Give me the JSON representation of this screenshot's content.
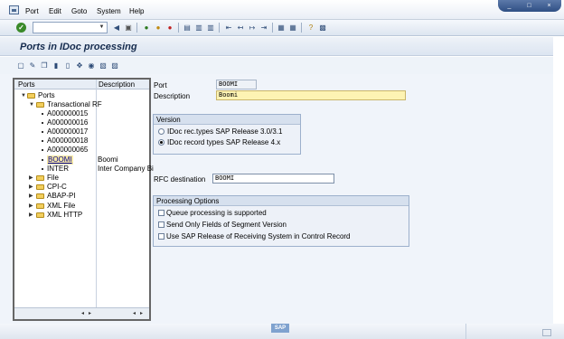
{
  "menu": {
    "items": [
      "Port",
      "Edit",
      "Goto",
      "System",
      "Help"
    ]
  },
  "window_controls": [
    "_",
    "□",
    "×"
  ],
  "toolbar": {
    "command_field_value": ""
  },
  "page": {
    "title": "Ports in IDoc processing"
  },
  "tree": {
    "columns": [
      "Ports",
      "Description"
    ],
    "rows": [
      {
        "label": "Ports",
        "desc": ""
      },
      {
        "label": "Transactional RF",
        "desc": ""
      },
      {
        "label": "A000000015",
        "desc": ""
      },
      {
        "label": "A000000016",
        "desc": ""
      },
      {
        "label": "A000000017",
        "desc": ""
      },
      {
        "label": "A000000018",
        "desc": ""
      },
      {
        "label": "A000000065",
        "desc": ""
      },
      {
        "label": "BOOMI",
        "desc": "Boomi"
      },
      {
        "label": "INTER",
        "desc": "Inter Company Bi"
      },
      {
        "label": "File",
        "desc": ""
      },
      {
        "label": "CPI-C",
        "desc": ""
      },
      {
        "label": "ABAP-PI",
        "desc": ""
      },
      {
        "label": "XML File",
        "desc": ""
      },
      {
        "label": "XML HTTP",
        "desc": ""
      }
    ],
    "scroll": [
      "◂",
      "▸",
      "◂",
      "▸"
    ]
  },
  "form": {
    "port_label": "Port",
    "port_value": "BOOMI",
    "description_label": "Description",
    "description_value": "Boomi",
    "version": {
      "title": "Version",
      "options": [
        "IDoc rec.types SAP Release 3.0/3.1",
        "IDoc record types SAP Release 4.x"
      ],
      "selected_index": 1
    },
    "rfc_label": "RFC destination",
    "rfc_value": "BOOMI",
    "processing": {
      "title": "Processing Options",
      "options": [
        "Queue processing is supported",
        "Send Only Fields of Segment Version",
        "Use SAP Release of Receiving System in Control Record"
      ]
    }
  },
  "status": {
    "logo_text": "SAP"
  },
  "colors": {
    "title_text": "#152b4e",
    "selection_bg": "#f8e9a6",
    "required_field_bg": "#fdf3b3",
    "panel_bg": "#f0f4fa"
  }
}
